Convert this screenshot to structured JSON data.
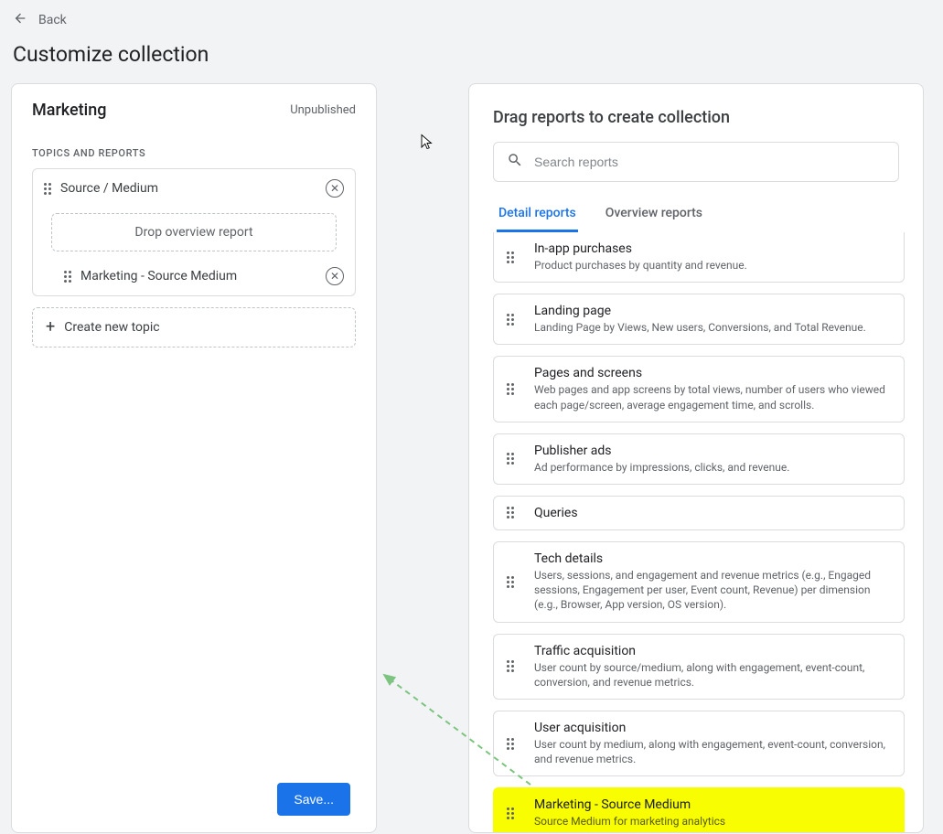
{
  "header": {
    "back_label": "Back",
    "page_title": "Customize collection"
  },
  "collection": {
    "name": "Marketing",
    "status": "Unpublished",
    "section_label": "TOPICS AND REPORTS",
    "topic_name": "Source / Medium",
    "drop_hint": "Drop overview report",
    "report_name": "Marketing - Source Medium",
    "create_topic_label": "Create new topic",
    "save_label": "Save..."
  },
  "right": {
    "title": "Drag reports to create collection",
    "search_placeholder": "Search reports",
    "tabs": {
      "detail": "Detail reports",
      "overview": "Overview reports"
    },
    "reports": [
      {
        "title": "In-app purchases",
        "desc": "Product purchases by quantity and revenue."
      },
      {
        "title": "Landing page",
        "desc": "Landing Page by Views, New users, Conversions, and Total Revenue."
      },
      {
        "title": "Pages and screens",
        "desc": "Web pages and app screens by total views, number of users who viewed each page/screen, average engagement time, and scrolls."
      },
      {
        "title": "Publisher ads",
        "desc": "Ad performance by impressions, clicks, and revenue."
      },
      {
        "title": "Queries",
        "desc": ""
      },
      {
        "title": "Tech details",
        "desc": "Users, sessions, and engagement and revenue metrics (e.g., Engaged sessions, Engagement per user, Event count, Revenue) per dimension (e.g., Browser, App version, OS version)."
      },
      {
        "title": "Traffic acquisition",
        "desc": "User count by source/medium, along with engagement, event-count, conversion, and revenue metrics."
      },
      {
        "title": "User acquisition",
        "desc": "User count by medium, along with engagement, event-count, conversion, and revenue metrics."
      },
      {
        "title": "Marketing - Source Medium",
        "desc": "Source Medium for marketing analytics"
      }
    ]
  }
}
